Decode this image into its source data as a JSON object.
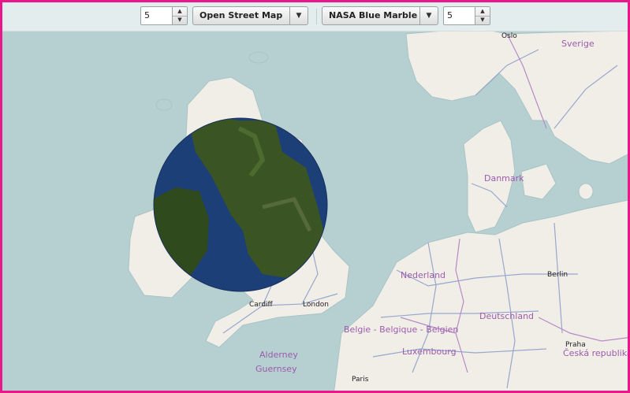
{
  "toolbar": {
    "left_zoom": "5",
    "left_layer": "Open Street Map",
    "right_layer": "NASA Blue Marble",
    "right_zoom": "5",
    "spin_up_icon": "triangle-up",
    "spin_down_icon": "triangle-down",
    "dropdown_icon": "chevron-down"
  },
  "map": {
    "countries": [
      "Sverige",
      "Danmark",
      "Nederland",
      "Deutschland",
      "Belgie - Belgique - Belgien",
      "Luxembourg",
      "Česká republika"
    ],
    "cities": [
      "Oslo",
      "Berlin",
      "Cardiff",
      "London",
      "Praha",
      "Paris"
    ],
    "islands": [
      "Alderney",
      "Guernsey"
    ]
  },
  "colors": {
    "border": "#e8178a",
    "sea": "#b6d0d1",
    "land": "#f1eee8",
    "country_label": "#9b5cab",
    "satellite_sea": "#1d3f78",
    "satellite_land": "#3a5523"
  }
}
